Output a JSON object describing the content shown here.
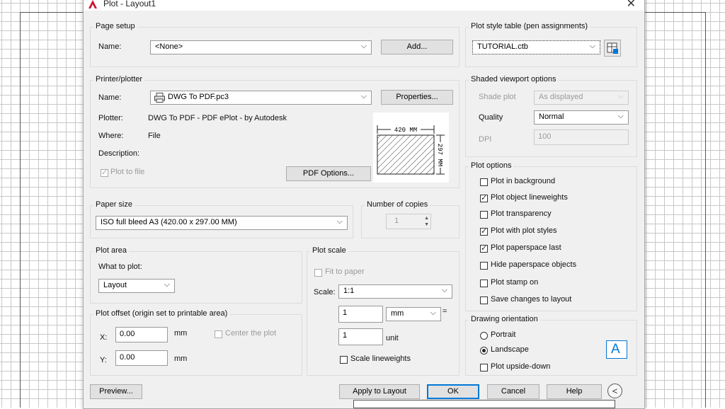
{
  "window": {
    "title": "Plot - Layout1",
    "close": "✕"
  },
  "page_setup": {
    "group": "Page setup",
    "name_label": "Name:",
    "name_value": "<None>",
    "add_button": "Add..."
  },
  "printer": {
    "group": "Printer/plotter",
    "name_label": "Name:",
    "name_value": "DWG To PDF.pc3",
    "properties_button": "Properties...",
    "plotter_label": "Plotter:",
    "plotter_value": "DWG To PDF - PDF ePlot - by Autodesk",
    "where_label": "Where:",
    "where_value": "File",
    "description_label": "Description:",
    "plot_to_file": "Plot to file",
    "pdf_options_button": "PDF Options...",
    "preview_width": "420 MM",
    "preview_height": "297 MM"
  },
  "paper_size": {
    "group": "Paper size",
    "value": "ISO full bleed A3 (420.00 x 297.00 MM)"
  },
  "copies": {
    "group": "Number of copies",
    "value": "1"
  },
  "plot_area": {
    "group": "Plot area",
    "what_label": "What to plot:",
    "value": "Layout"
  },
  "plot_offset": {
    "group": "Plot offset (origin set to printable area)",
    "x_label": "X:",
    "x_value": "0.00",
    "x_unit": "mm",
    "y_label": "Y:",
    "y_value": "0.00",
    "y_unit": "mm",
    "center": "Center the plot"
  },
  "plot_scale": {
    "group": "Plot scale",
    "fit": "Fit to paper",
    "scale_label": "Scale:",
    "scale_value": "1:1",
    "val1": "1",
    "unit1": "mm",
    "equals": "=",
    "val2": "1",
    "unit2": "unit",
    "scale_lineweights": "Scale lineweights"
  },
  "style_table": {
    "group": "Plot style table (pen assignments)",
    "value": "TUTORIAL.ctb"
  },
  "shaded": {
    "group": "Shaded viewport options",
    "shade_label": "Shade plot",
    "shade_value": "As displayed",
    "quality_label": "Quality",
    "quality_value": "Normal",
    "dpi_label": "DPI",
    "dpi_value": "100"
  },
  "plot_options": {
    "group": "Plot options",
    "items": [
      {
        "label": "Plot in background",
        "checked": false
      },
      {
        "label": "Plot object lineweights",
        "checked": true
      },
      {
        "label": "Plot transparency",
        "checked": false
      },
      {
        "label": "Plot with plot styles",
        "checked": true
      },
      {
        "label": "Plot paperspace last",
        "checked": true
      },
      {
        "label": "Hide paperspace objects",
        "checked": false
      },
      {
        "label": "Plot stamp on",
        "checked": false
      },
      {
        "label": "Save changes to layout",
        "checked": false
      }
    ]
  },
  "orientation": {
    "group": "Drawing orientation",
    "portrait": "Portrait",
    "landscape": "Landscape",
    "upside_down": "Plot upside-down",
    "icon_letter": "A"
  },
  "footer": {
    "preview": "Preview...",
    "apply": "Apply to Layout",
    "ok": "OK",
    "cancel": "Cancel",
    "help": "Help"
  },
  "colors": {
    "accent": "#0078d7",
    "autocad_red": "#c8102e"
  }
}
